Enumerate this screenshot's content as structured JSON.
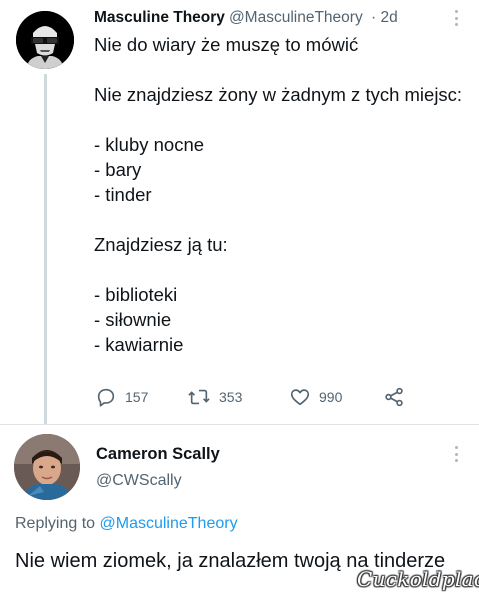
{
  "tweet": {
    "author_name": "Masculine Theory",
    "author_handle": "@MasculineTheory",
    "time": "· 2d",
    "lines": [
      "Nie do wiary że muszę to mówić",
      "",
      "Nie znajdziesz żony w żadnym z tych miejsc:",
      "",
      "- kluby nocne",
      "- bary",
      "- tinder",
      "",
      "Znajdziesz ją tu:",
      "",
      "- biblioteki",
      "- siłownie",
      "- kawiarnie"
    ],
    "actions": {
      "replies": "157",
      "retweets": "353",
      "likes": "990"
    }
  },
  "reply": {
    "author_name": "Cameron Scally",
    "author_handle": "@CWScally",
    "replying_prefix": "Replying to",
    "replying_handle": "@MasculineTheory",
    "text": "Nie wiem ziomek, ja znalazłem twoją na tinderze"
  },
  "watermark": "Cuckoldplace",
  "icons": {
    "reply": "comment-icon",
    "retweet": "retweet-icon",
    "like": "heart-icon",
    "share": "share-icon",
    "more": "more-vertical-icon"
  },
  "colors": {
    "text": "#0f1419",
    "secondary": "#536471",
    "link": "#1d9bf0",
    "thread_line": "#cfd9de"
  }
}
